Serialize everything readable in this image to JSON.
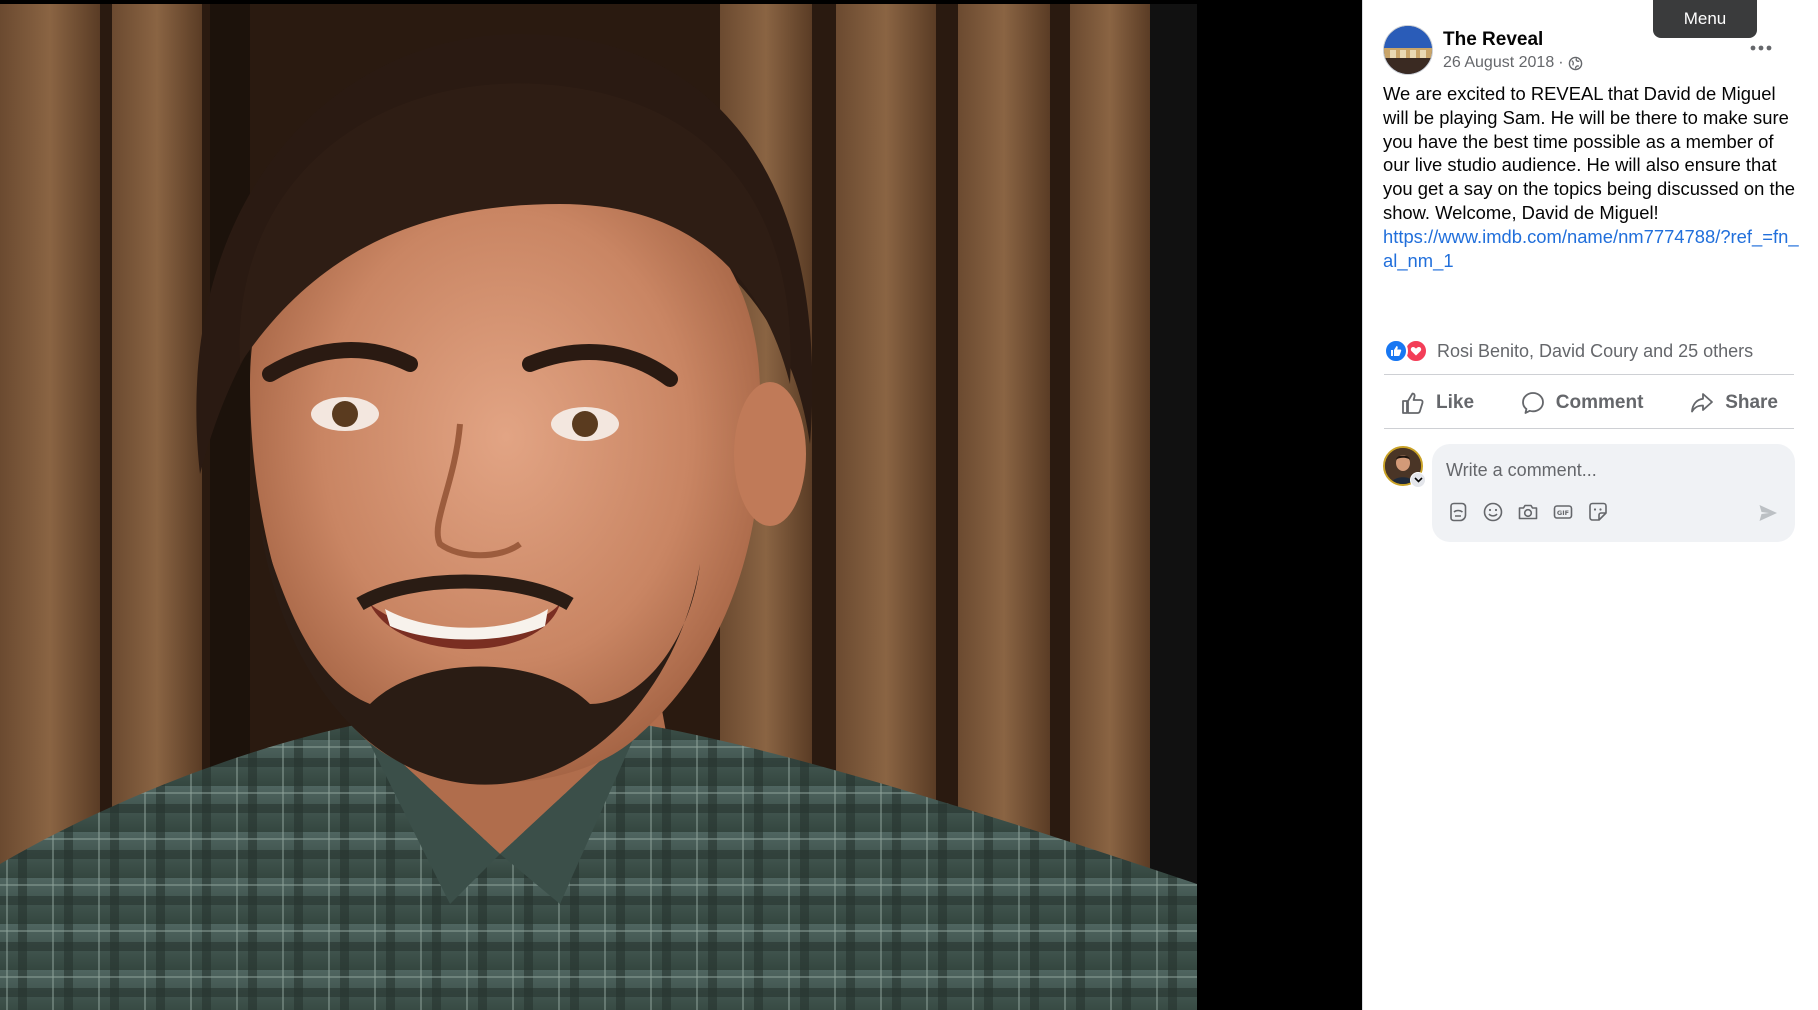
{
  "viewer": {
    "photo_description_icon": "photo"
  },
  "tooltip": {
    "label": "Menu"
  },
  "post": {
    "page_name": "The Reveal",
    "date": "26 August 2018",
    "separator": "·",
    "audience_icon": "globe-icon",
    "more_icon": "more-horizontal-icon",
    "body_text": "We are excited to REVEAL that David de Miguel will be playing Sam. He will be there to make sure you have the best time possible as a member of our live studio audience. He will also ensure that you get a say on the topics being discussed on the show. Welcome, David de Miguel!",
    "link_text": "https://www.imdb.com/name/nm7774788/?ref_=fn_al_nm_1"
  },
  "reactions": {
    "icons": [
      "like-reaction-icon",
      "love-reaction-icon"
    ],
    "summary": "Rosi Benito, David Coury and 25 others"
  },
  "actions": {
    "like": "Like",
    "comment": "Comment",
    "share": "Share"
  },
  "comment_composer": {
    "placeholder": "Write a comment...",
    "tools": [
      "avatar-sticker-icon",
      "emoji-icon",
      "camera-icon",
      "gif-icon",
      "sticker-icon"
    ],
    "send_icon": "send-icon"
  },
  "colors": {
    "accent": "#1877f2",
    "link": "#216fdb",
    "love": "#f33e58",
    "secondary_text": "#65676b",
    "composer_bg": "#f0f2f5"
  }
}
